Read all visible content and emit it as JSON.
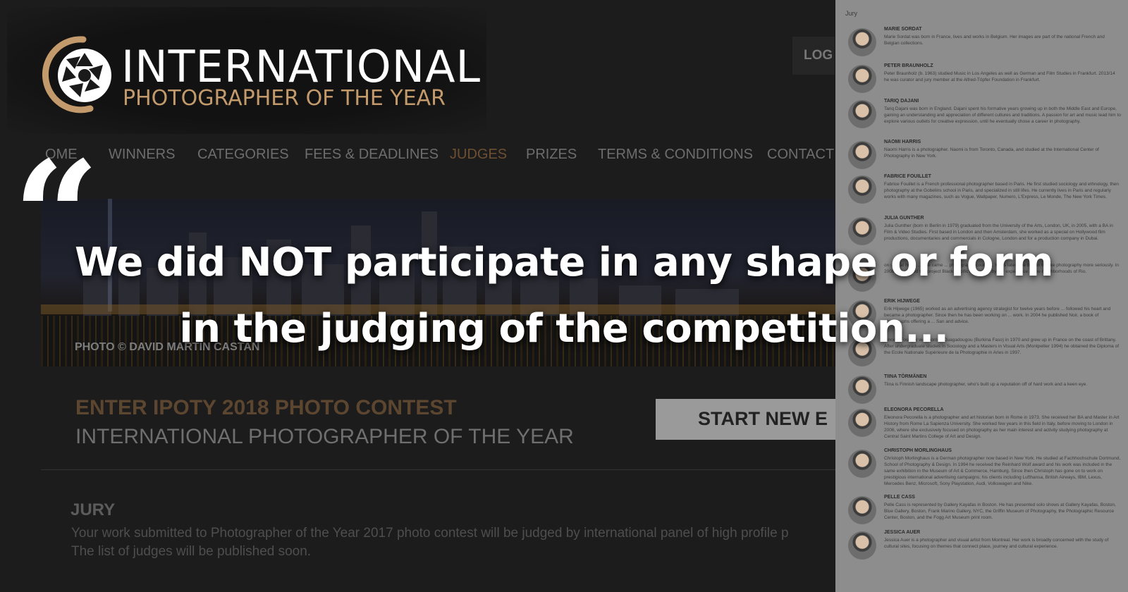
{
  "logo": {
    "line1": "INTERNATIONAL",
    "line2": "PHOTOGRAPHER OF THE YEAR",
    "accent": "#c39a6b"
  },
  "header": {
    "login_label": "LOG"
  },
  "nav": {
    "partial_first": "OME",
    "items": [
      "WINNERS",
      "CATEGORIES",
      "FEES & DEADLINES",
      "JUDGES",
      "PRIZES",
      "TERMS & CONDITIONS",
      "CONTACT"
    ],
    "active": "JUDGES"
  },
  "quote_glyph": "“",
  "banner": {
    "credit": "PHOTO © DAVID MARTIN CASTAN"
  },
  "enter": {
    "title": "ENTER IPOTY 2018 PHOTO CONTEST",
    "subtitle": "INTERNATIONAL PHOTOGRAPHER OF THE YEAR",
    "start_label": "START NEW E"
  },
  "jury": {
    "heading": "JURY",
    "line1": "Your work submitted to Photographer of the Year 2017 photo contest will be judged by international panel of high profile p",
    "line2": "The list of judges will be published soon."
  },
  "panel": {
    "title": "Jury",
    "jurors": [
      {
        "name": "MARIE SORDAT",
        "bio": "Marie Sordat was born in France, lives and works in Belgium. Her images are part of the national French and Belgian collections."
      },
      {
        "name": "PETER BRAUNHOLZ",
        "bio": "Peter Braunholz (b. 1963) studied Music in Los Angeles as well as German and Film Studies in Frankfurt. 2013/14 he was curator and jury member at the Alfred-Töpfer Foundation in Frankfurt."
      },
      {
        "name": "TARIQ DAJANI",
        "bio": "Tariq Dajani was born in England. Dajani spent his formative years growing up in both the Middle East and Europe, gaining an understanding and appreciation of different cultures and traditions. A passion for art and music lead him to explore various outlets for creative expression, until he eventually chose a career in photography."
      },
      {
        "name": "NAOMI HARRIS",
        "bio": "Naomi Harris is a photographer. Naomi is from Toronto, Canada, and studied at the International Center of Photography in New York."
      },
      {
        "name": "FABRICE FOUILLET",
        "bio": "Fabrice Fouillet is a French professional photographer based in Paris. He first studied sociology and ethnology, then photography at the Gobelins school in Paris, and specialized in still lifes. He currently lives in Paris and regularly works with many magazines, such as Vogue, Wallpaper, Numero, L'Express, Le Monde, The New York Times."
      },
      {
        "name": "JULIA GUNTHER",
        "bio": "Julia Gunther (born in Berlin in 1979) graduated from the University of the Arts, London, UK, in 2005, with a BA in Film & Video Studies. First based in London and then Amsterdam, she worked as a special on Hollywood film productions, documentaries and commercials in Cologne, London and for a production company in Dubai."
      },
      {
        "name": "",
        "bio": "on stay at home ... she came ... photography courses. Years later, she began to take photography more seriously. In 2008 she started the project Black Pacific influenced by her experience in the neighborhoods of Rio."
      },
      {
        "name": "ERIK HIJWEGE",
        "bio": "Erik Hijwege (1965) worked as an advertising agency strategist for twelve years before ... followed his heart and became a photographer. Since then he has been working on ... work. In 2004 he published Noir, a book of photographs offering a ... San and advice."
      },
      {
        "name": "",
        "bio": "Vincent Fournier was born in Ouagadougou (Burkina Faso) in 1970 and grew up in France on the coast of Brittany. After undergraduate studies in Sociology and a Masters in Visual Arts (Montpellier 1994) he obtained the Diploma of the Ecole Nationale Supérieure de la Photographie in Arles in 1997."
      },
      {
        "name": "TIINA TÖRMÄNEN",
        "bio": "Tiina is Finnish landscape photographer, who's built up a reputation off of hard work and a keen eye."
      },
      {
        "name": "ELEONORA PECORELLA",
        "bio": "Eleonora Pecorella is a photographer and art historian born in Rome in 1973. She received her BA and Master in Art History from Rome La Sapienza University. She worked few years in this field in Italy, before moving to London in 2006, where she exclusively focused on photography as her main interest and activity studying photography at Central Saint Martins College of Art and Design."
      },
      {
        "name": "CHRISTOPH MORLINGHAUS",
        "bio": "Christoph Morlinghaus is a German photographer now based in New York. He studied at Fachhochschule Dortmund, School of Photography & Design. In 1994 he received the Reinhard Wolf award and his work was included in the same exhibition in the Museum of Art & Commerce, Hamburg. Since then Christoph has gone on to work on prestigious international advertising campaigns; his clients including Lufthansa, British Airways, IBM, Lexus, Mercedes Benz, Microsoft, Sony Playstation, Audi, Volkswagen and Nike."
      },
      {
        "name": "PELLE CASS",
        "bio": "Pelle Cass is represented by Gallery Kayafas in Boston. He has presented solo shows at Gallery Kayafas, Boston, Blue Gallery, Boston, Frank Marino Gallery, NYC, the Griffin Museum of Photography, the Photographic Resource Center, Boston, and the Fogg Art Museum print room."
      },
      {
        "name": "JESSICA AUER",
        "bio": "Jessica Auer is a photographer and visual artist from Montreal. Her work is broadly concerned with the study of cultural sites, focusing on themes that connect place, journey and cultural experience."
      }
    ]
  },
  "headline": {
    "line1": "We did NOT participate in any shape or form",
    "line2": "in the judging of the competition..."
  }
}
